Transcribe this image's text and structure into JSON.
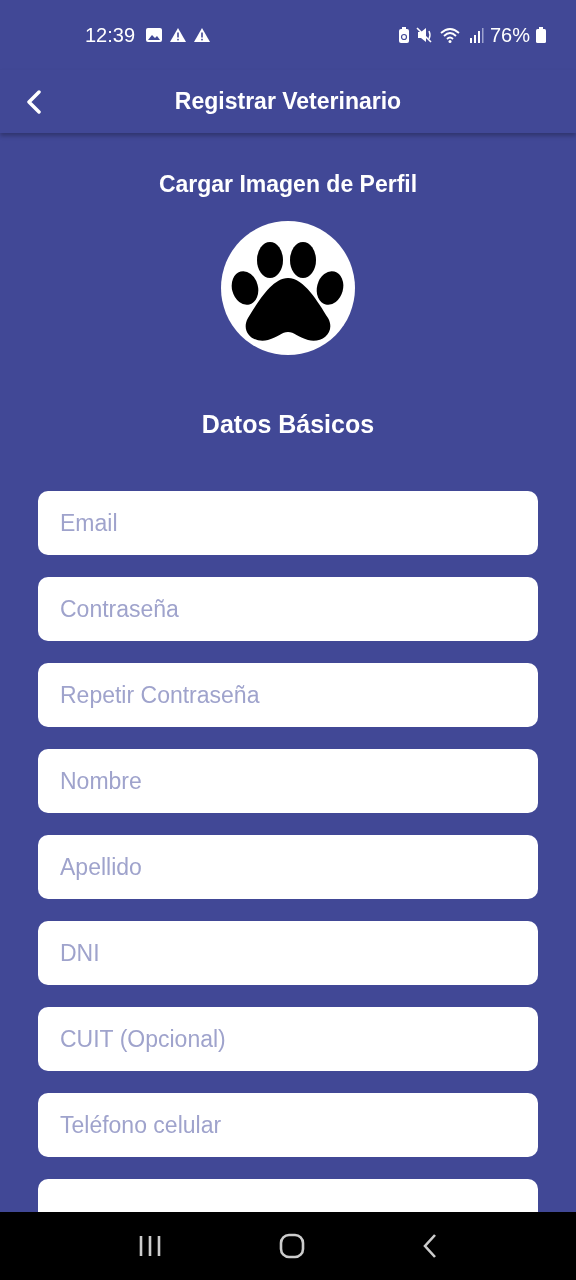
{
  "status_bar": {
    "time": "12:39",
    "battery": "76%"
  },
  "header": {
    "title": "Registrar Veterinario"
  },
  "profile": {
    "label": "Cargar Imagen de Perfil"
  },
  "section": {
    "title": "Datos Básicos"
  },
  "fields": [
    {
      "kind": "text",
      "placeholder": "Email"
    },
    {
      "kind": "text",
      "placeholder": "Contraseña"
    },
    {
      "kind": "text",
      "placeholder": "Repetir Contraseña"
    },
    {
      "kind": "text",
      "placeholder": "Nombre"
    },
    {
      "kind": "text",
      "placeholder": "Apellido"
    },
    {
      "kind": "text",
      "placeholder": "DNI"
    },
    {
      "kind": "text",
      "placeholder": "CUIT (Opcional)"
    },
    {
      "kind": "text",
      "placeholder": "Teléfono celular"
    },
    {
      "kind": "cut_off"
    }
  ]
}
